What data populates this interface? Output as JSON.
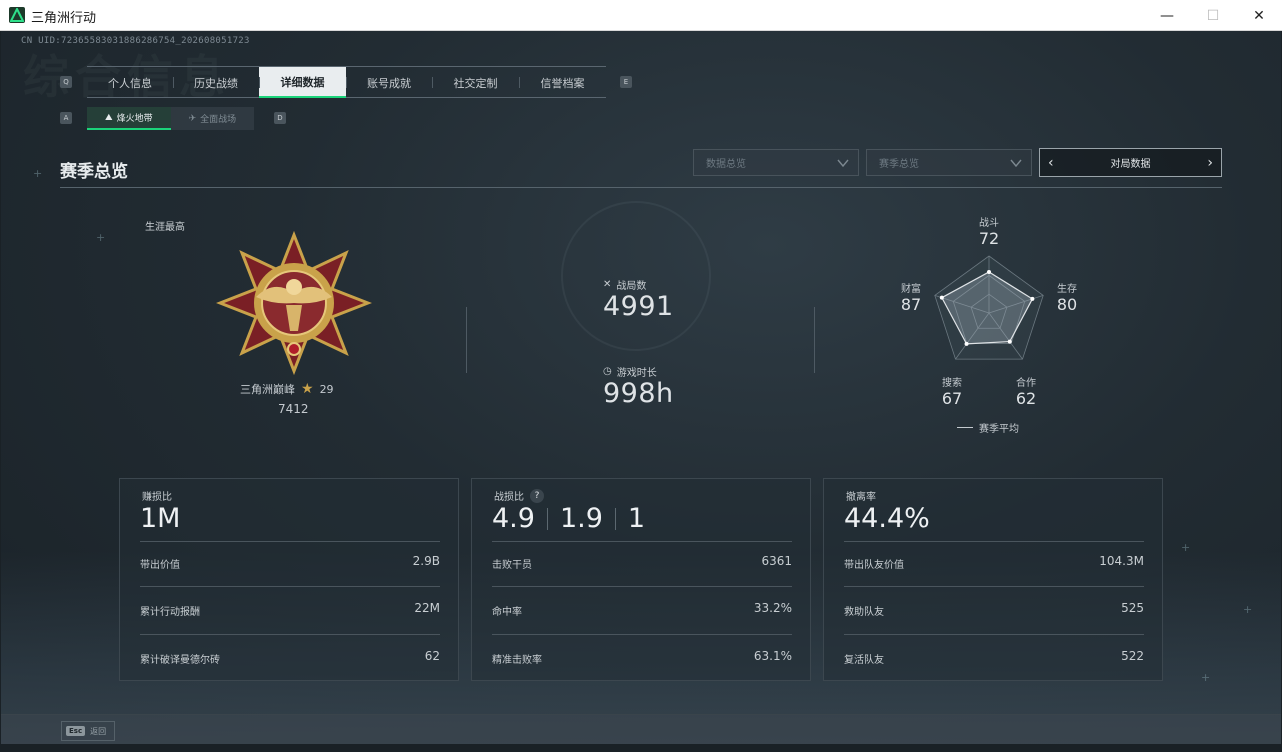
{
  "window": {
    "title": "三角洲行动",
    "minimize": "—",
    "maximize": "☐",
    "close": "✕"
  },
  "uid": "CN UID:72365583031886286754_202608051723",
  "watermark": "综合信息",
  "tabs": [
    "个人信息",
    "历史战绩",
    "详细数据",
    "账号成就",
    "社交定制",
    "信誉档案"
  ],
  "active_tab": 2,
  "tab_hints": {
    "left": "Q",
    "right": "E"
  },
  "subtabs": [
    {
      "label": "烽火地带",
      "icon": "⛰",
      "active": true
    },
    {
      "label": "全面战场",
      "icon": "✈",
      "active": false
    }
  ],
  "subtab_hints": {
    "left": "A",
    "right": "D"
  },
  "section": {
    "title": "赛季总览",
    "select_data": "数据总览",
    "select_season": "赛季总览",
    "switcher_label": "对局数据"
  },
  "career": {
    "label": "生涯最高",
    "rank_name": "三角洲巅峰",
    "rank_stars": "29",
    "rank_score": "7412"
  },
  "stats": {
    "matches_label": "战局数",
    "matches_value": "4991",
    "playtime_label": "游戏时长",
    "playtime_value": "998h"
  },
  "radar": {
    "axes": [
      {
        "label": "战斗",
        "value": "72",
        "score": 72
      },
      {
        "label": "生存",
        "value": "80",
        "score": 80
      },
      {
        "label": "合作",
        "value": "62",
        "score": 62
      },
      {
        "label": "搜索",
        "value": "67",
        "score": 67
      },
      {
        "label": "财富",
        "value": "87",
        "score": 87
      }
    ],
    "legend": "赛季平均"
  },
  "panels": [
    {
      "title": "赚损比",
      "big": [
        "1M"
      ],
      "rows": [
        {
          "k": "带出价值",
          "v": "2.9B"
        },
        {
          "k": "累计行动报酬",
          "v": "22M"
        },
        {
          "k": "累计破译曼德尔砖",
          "v": "62"
        }
      ]
    },
    {
      "title": "战损比",
      "help": "?",
      "big": [
        "4.9",
        "1.9",
        "1"
      ],
      "rows": [
        {
          "k": "击败干员",
          "v": "6361"
        },
        {
          "k": "命中率",
          "v": "33.2%"
        },
        {
          "k": "精准击败率",
          "v": "63.1%"
        }
      ]
    },
    {
      "title": "撤离率",
      "big": [
        "44.4%"
      ],
      "rows": [
        {
          "k": "带出队友价值",
          "v": "104.3M"
        },
        {
          "k": "救助队友",
          "v": "525"
        },
        {
          "k": "复活队友",
          "v": "522"
        }
      ]
    }
  ],
  "bottom": {
    "esc_key": "Esc",
    "esc_label": "返回"
  }
}
